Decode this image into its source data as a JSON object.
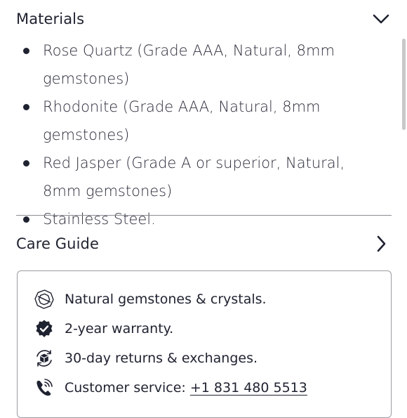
{
  "materials": {
    "title": "Materials",
    "items": [
      "Rose Quartz (Grade AAA, Natural, 8mm gemstones)",
      "Rhodonite (Grade AAA, Natural, 8mm gemstones)",
      "Red Jasper (Grade A or superior, Natural, 8mm gemstones)",
      "Stainless Steel."
    ]
  },
  "care_guide": {
    "title": "Care Guide"
  },
  "info": {
    "gemstones": "Natural gemstones & crystals.",
    "warranty": "2-year warranty.",
    "returns": "30-day returns & exchanges.",
    "service_label": "Customer service: ",
    "service_phone": "+1 831 480 5513"
  },
  "icons": {
    "materials_toggle": "chevron-down-icon",
    "care_toggle": "chevron-right-icon",
    "gemstones": "gem-icon",
    "warranty": "badge-check-icon",
    "returns": "box-return-icon",
    "service": "phone-icon"
  }
}
